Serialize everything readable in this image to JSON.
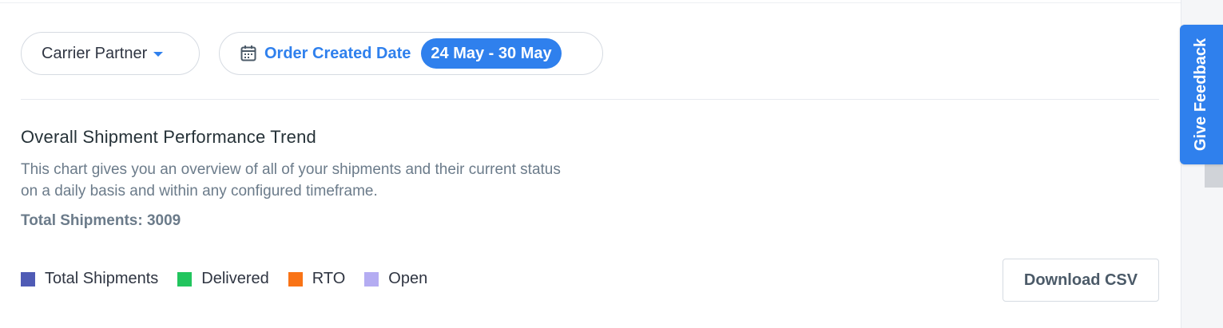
{
  "filters": {
    "carrier_partner_label": "Carrier Partner",
    "date_filter": {
      "label": "Order Created Date",
      "range": "24 May - 30 May"
    }
  },
  "section": {
    "title": "Overall Shipment Performance Trend",
    "description": "This chart gives you an overview of all of your shipments and their current status on a daily basis and within any configured timeframe.",
    "total_shipments_text": "Total Shipments: 3009"
  },
  "legend": {
    "items": [
      {
        "label": "Total Shipments",
        "color": "#4f5bb5"
      },
      {
        "label": "Delivered",
        "color": "#22c55e"
      },
      {
        "label": "RTO",
        "color": "#f97316"
      },
      {
        "label": "Open",
        "color": "#b4acf2"
      }
    ]
  },
  "actions": {
    "download_csv": "Download CSV"
  },
  "feedback": {
    "label": "Give Feedback"
  },
  "colors": {
    "accent": "#2f80ed",
    "muted_text": "#6b7b8a"
  }
}
